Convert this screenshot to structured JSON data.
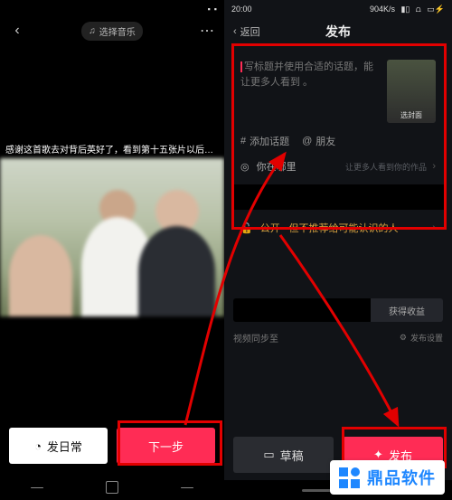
{
  "left": {
    "statusbar": {
      "blur_text": ""
    },
    "top": {
      "music_chip": "选择音乐"
    },
    "caption": "感谢这首歌去对背后英好了，看到第十五张片以后…",
    "buttons": {
      "daily": "发日常",
      "next": "下一步"
    }
  },
  "right": {
    "statusbar": {
      "time": "20:00",
      "net": "904K/s",
      "signal": "📶",
      "wifi": "📶",
      "batt": "⚡"
    },
    "header": {
      "back": "返回",
      "title": "发布"
    },
    "form": {
      "title_placeholder": "写标题并使用合适的话题，能让更多人看到 。",
      "cover_label": "选封面",
      "hashtag": "添加话题",
      "mention": "朋友",
      "location_label": "你在哪里",
      "location_sub": "让更多人看到你的作品",
      "privacy": "公开 · 但不推荐给可能认识的人"
    },
    "lower": {
      "earn": "获得收益",
      "sync": "视频同步至",
      "settings": "发布设置"
    },
    "bottom": {
      "draft": "草稿",
      "publish": "发布"
    }
  },
  "watermark": "鼎品软件"
}
